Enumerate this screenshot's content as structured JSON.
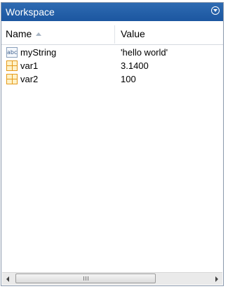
{
  "window": {
    "title": "Workspace"
  },
  "columns": {
    "name": "Name",
    "value": "Value"
  },
  "variables": [
    {
      "icon": "abc",
      "icon_text": "abc",
      "name": "myString",
      "value": "'hello world'"
    },
    {
      "icon": "grid",
      "icon_text": "",
      "name": "var1",
      "value": "3.1400"
    },
    {
      "icon": "grid",
      "icon_text": "",
      "name": "var2",
      "value": "100"
    }
  ],
  "scrollbar": {
    "position": 0
  },
  "colors": {
    "title_bar": "#1c56a0",
    "border": "#8a98ac"
  }
}
